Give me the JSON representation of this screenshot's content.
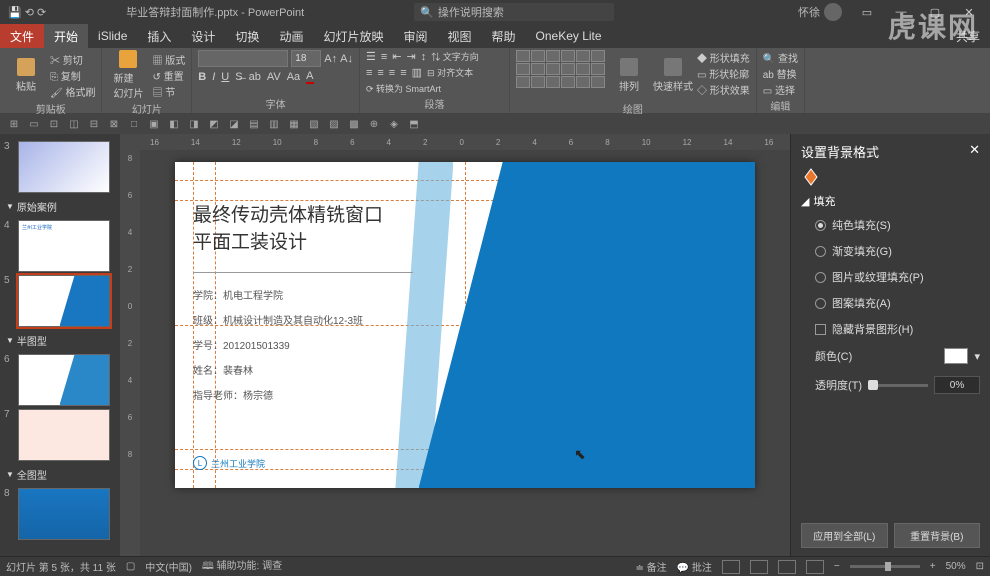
{
  "title": {
    "doc": "毕业答辩封面制作.pptx",
    "app": "PowerPoint",
    "search_placeholder": "操作说明搜索",
    "user": "怀徐",
    "share": "共享"
  },
  "menu": {
    "file": "文件",
    "home": "开始",
    "islide": "iSlide",
    "insert": "插入",
    "design": "设计",
    "transitions": "切换",
    "animations": "动画",
    "slideshow": "幻灯片放映",
    "review": "审阅",
    "view": "视图",
    "help": "帮助",
    "onekey": "OneKey Lite"
  },
  "ribbon": {
    "paste": "粘贴",
    "cut": "剪切",
    "copy": "复制",
    "format_painter": "格式刷",
    "clipboard": "剪贴板",
    "new_slide": "新建\n幻灯片",
    "layout": "版式",
    "reset": "重置",
    "section": "节",
    "slides": "幻灯片",
    "font_size": "18",
    "font": "字体",
    "paragraph": "段落",
    "text_dir": "文字方向",
    "align_text": "对齐文本",
    "smartart": "转换为 SmartArt",
    "drawing": "绘图",
    "arrange": "排列",
    "quick_styles": "快速样式",
    "shape_fill": "形状填充",
    "shape_outline": "形状轮廓",
    "shape_effects": "形状效果",
    "editing": "编辑",
    "find": "查找",
    "replace": "替换",
    "select": "选择"
  },
  "thumbs": {
    "section1": "原始案例",
    "section2": "半图型",
    "section3": "全图型"
  },
  "slide": {
    "title_line1": "最终传动壳体精铣窗口",
    "title_line2": "平面工装设计",
    "info1": "学院：机电工程学院",
    "info2": "班级：机械设计制造及其自动化12-3班",
    "info3": "学号：201201501339",
    "info4": "姓名：裴春林",
    "info5": "指导老师：杨宗德",
    "logo": "兰州工业学院"
  },
  "format": {
    "title": "设置背景格式",
    "fill": "填充",
    "solid": "纯色填充(S)",
    "gradient": "渐变填充(G)",
    "picture": "图片或纹理填充(P)",
    "pattern": "图案填充(A)",
    "hide_bg": "隐藏背景图形(H)",
    "color": "颜色(C)",
    "transparency": "透明度(T)",
    "pct": "0%",
    "apply_all": "应用到全部(L)",
    "reset_bg": "重置背景(B)"
  },
  "status": {
    "slide_info": "幻灯片 第 5 张，共 11 张",
    "lang": "中文(中国)",
    "acc": "辅助功能: 调查",
    "notes": "备注",
    "comments": "批注",
    "zoom": "50%"
  },
  "watermark": "虎课网"
}
